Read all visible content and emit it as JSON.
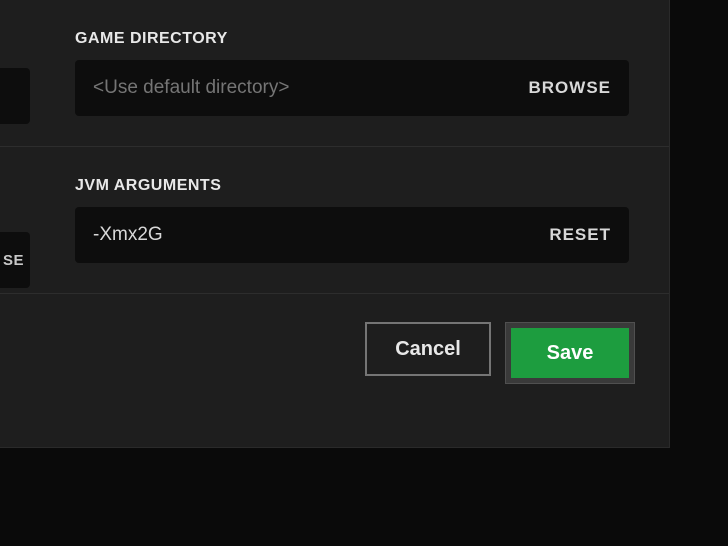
{
  "gameDirectory": {
    "label": "GAME DIRECTORY",
    "placeholder": "<Use default directory>",
    "value": "",
    "browseLabel": "BROWSE"
  },
  "jvmArguments": {
    "label": "JVM ARGUMENTS",
    "value": "-Xmx2G",
    "resetLabel": "RESET",
    "leftStubText": "SE"
  },
  "buttons": {
    "cancel": "Cancel",
    "save": "Save"
  },
  "colors": {
    "accent": "#1d9d3f",
    "background": "#1e1e1e",
    "inputBg": "#0d0d0d"
  }
}
